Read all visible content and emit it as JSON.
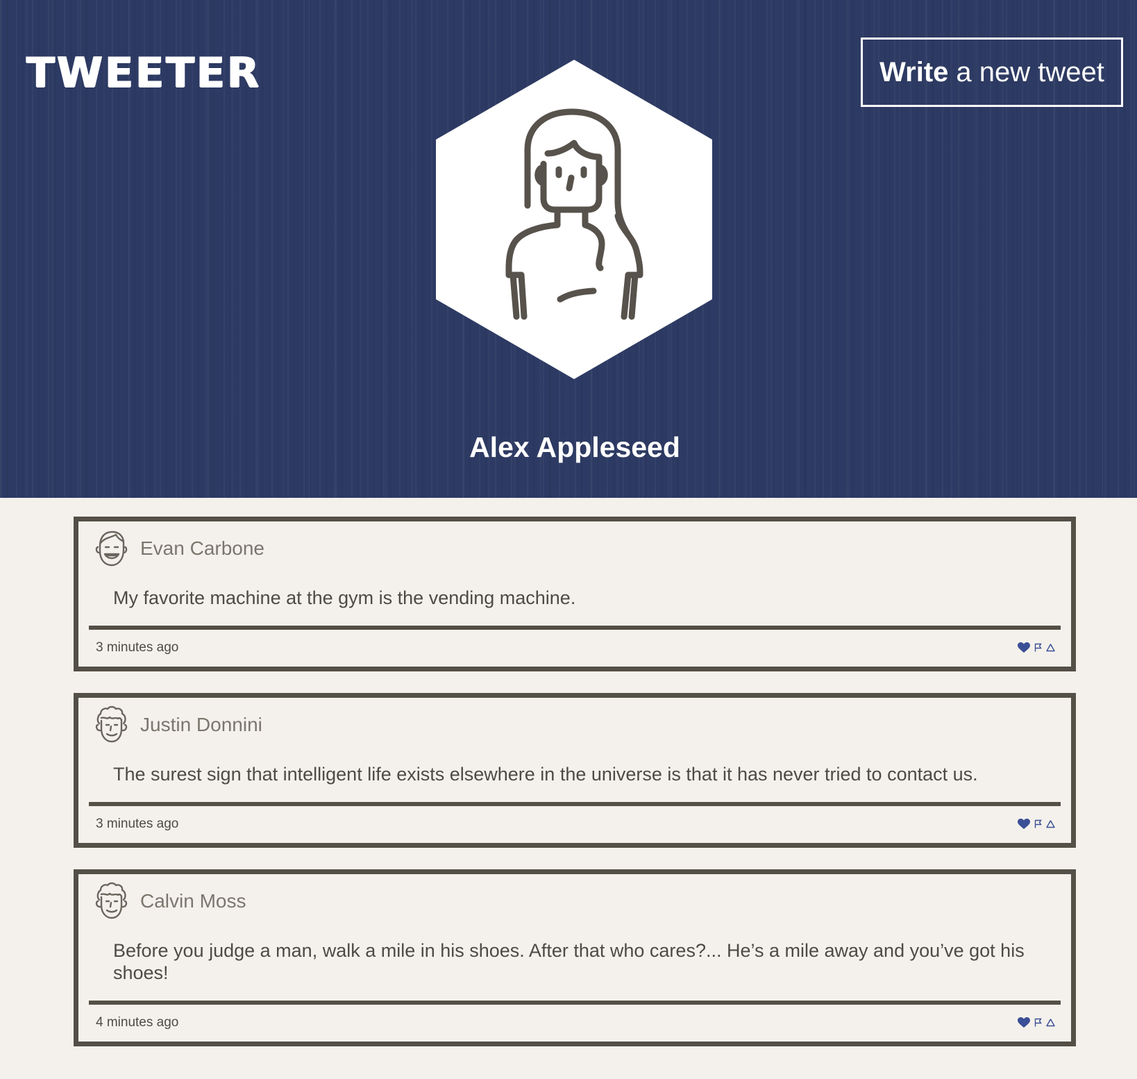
{
  "header": {
    "logo": "TWEETER",
    "compose_button": {
      "strong": "Write",
      "rest": "a new tweet"
    },
    "profile_name": "Alex Appleseed",
    "profile_avatar_icon": "woman-avatar-icon"
  },
  "actions_icons": [
    "heart-icon",
    "flag-icon",
    "retweet-icon"
  ],
  "colors": {
    "header_bg": "#2d3a63",
    "page_bg": "#f4f1ec",
    "border": "#545048",
    "action_accent": "#3b4f96"
  },
  "tweets": [
    {
      "author": "Evan Carbone",
      "avatar_icon": "smiling-man-avatar-icon",
      "text": "My favorite machine at the gym is the vending machine.",
      "time": "3 minutes ago"
    },
    {
      "author": "Justin Donnini",
      "avatar_icon": "curly-hair-man-avatar-icon",
      "text": "The surest sign that intelligent life exists elsewhere in the universe is that it has never tried to contact us.",
      "time": "3 minutes ago"
    },
    {
      "author": "Calvin Moss",
      "avatar_icon": "curly-hair-man-avatar-icon",
      "text": "Before you judge a man, walk a mile in his shoes. After that who cares?... He’s a mile away and you’ve got his shoes!",
      "time": "4 minutes ago"
    }
  ]
}
